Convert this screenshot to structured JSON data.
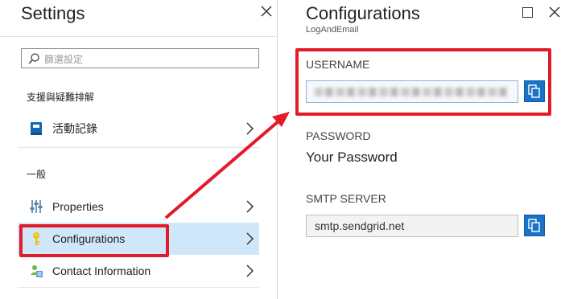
{
  "settings_blade": {
    "title": "Settings",
    "filter_placeholder": "篩選設定",
    "sections": [
      {
        "label": "支援與疑難排解"
      },
      {
        "label": "一般"
      }
    ],
    "items": [
      {
        "label": "活動記錄",
        "icon": "book-icon"
      },
      {
        "label": "Properties",
        "icon": "properties-sliders-icon"
      },
      {
        "label": "Configurations",
        "icon": "key-icon",
        "selected": true
      },
      {
        "label": "Contact Information",
        "icon": "contact-card-icon"
      }
    ]
  },
  "config_blade": {
    "title": "Configurations",
    "subtitle": "LogAndEmail",
    "username_label": "USERNAME",
    "password_label": "PASSWORD",
    "password_value": "Your Password",
    "smtp_label": "SMTP SERVER",
    "smtp_value": "smtp.sendgrid.net"
  },
  "colors": {
    "accent": "#1a73c9",
    "selected_bg": "#cfe7f9",
    "annotation_red": "#e01b2a"
  }
}
